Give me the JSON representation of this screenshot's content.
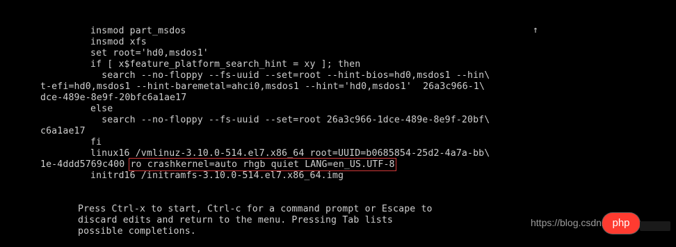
{
  "colors": {
    "background": "#000000",
    "text": "#cfcfcf",
    "highlight_box": "#d23a3a",
    "badge": "#ff3b30"
  },
  "editor": {
    "lines": [
      "insmod part_msdos",
      "insmod xfs",
      "set root='hd0,msdos1'",
      "if [ x$feature_platform_search_hint = xy ]; then",
      "  search --no-floppy --fs-uuid --set=root --hint-bios=hd0,msdos1 --hin\\",
      "t-efi=hd0,msdos1 --hint-baremetal=ahci0,msdos1 --hint='hd0,msdos1'  26a3c966-1\\",
      "dce-489e-8e9f-20bfc6a1ae17",
      "else",
      "  search --no-floppy --fs-uuid --set=root 26a3c966-1dce-489e-8e9f-20bf\\",
      "c6a1ae17",
      "fi",
      "linux16 /vmlinuz-3.10.0-514.el7.x86_64 root=UUID=b0685854-25d2-4a7a-bb\\",
      "1e-4ddd5769c400 ",
      "ro crashkernel=auto rhgb quiet LANG=en_US.UTF-8",
      "initrd16 /initramfs-3.10.0-514.el7.x86_64.img"
    ],
    "scroll_indicator": "↑"
  },
  "help": {
    "line1": "Press Ctrl-x to start, Ctrl-c for a command prompt or Escape to",
    "line2": "discard edits and return to the menu. Pressing Tab lists",
    "line3": "possible completions."
  },
  "watermark": {
    "text": "https://blog.csdn.net/qq",
    "badge": "php"
  }
}
